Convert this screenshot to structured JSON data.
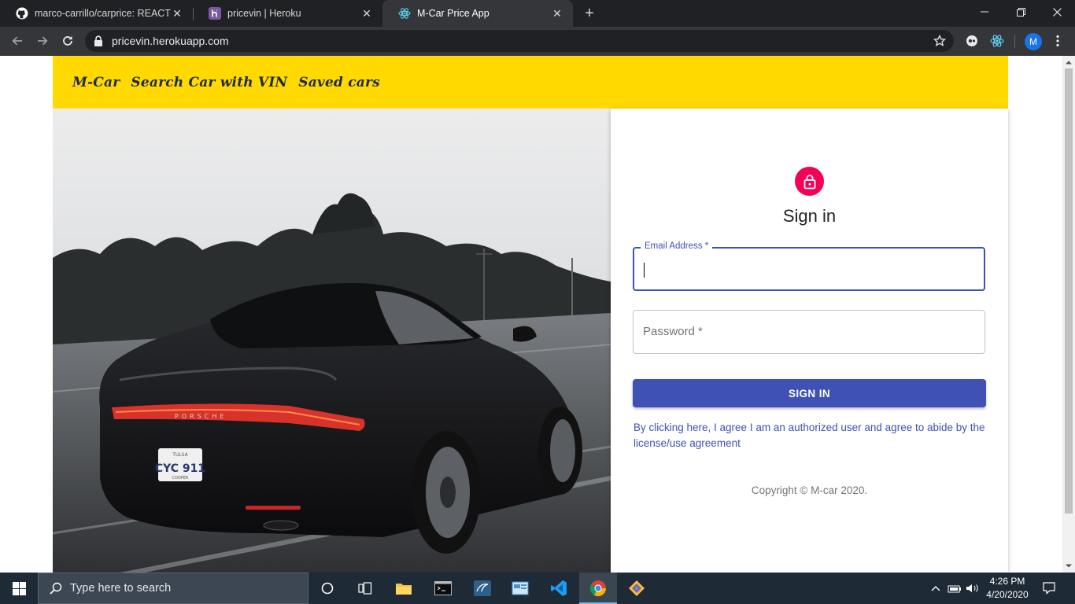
{
  "browser": {
    "tabs": [
      {
        "title": "marco-carrillo/carprice: REACT-b",
        "icon": "github-icon",
        "active": false
      },
      {
        "title": "pricevin | Heroku",
        "icon": "heroku-icon",
        "active": false
      },
      {
        "title": "M-Car Price App",
        "icon": "react-icon",
        "active": true
      }
    ],
    "url": "pricevin.herokuapp.com",
    "profile_initial": "M"
  },
  "navbar": {
    "brand": "M-Car",
    "links": [
      "Search Car with VIN",
      "Saved cars"
    ],
    "color": "#ffd900"
  },
  "hero": {
    "image": "porsche-car-photo",
    "brand_text": "PORSCHE",
    "plate_top": "TULSA",
    "plate": "CYC 911",
    "plate_bottom": "COOPER"
  },
  "signin": {
    "title": "Sign in",
    "email_label": "Email Address *",
    "password_placeholder": "Password *",
    "button": "SIGN IN",
    "agreement": "By clicking here, I agree I am an authorized user and agree to abide by the license/use agreement",
    "copyright": "Copyright © M-car 2020.",
    "accent": "#3f51b5",
    "avatar_color": "#f50057"
  },
  "taskbar": {
    "search_placeholder": "Type here to search",
    "time": "4:26 PM",
    "date": "4/20/2020"
  }
}
